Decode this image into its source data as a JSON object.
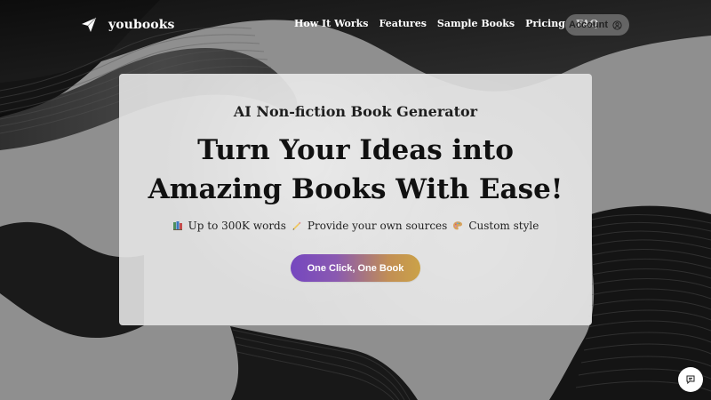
{
  "brand": {
    "name": "youbooks",
    "icon": "paper-plane-icon"
  },
  "nav": {
    "items": [
      {
        "label": "How It Works"
      },
      {
        "label": "Features"
      },
      {
        "label": "Sample Books"
      },
      {
        "label": "Pricing"
      },
      {
        "label": "FAQ"
      }
    ],
    "account_label": "Account",
    "account_icon": "user-circle-icon"
  },
  "hero": {
    "subtitle": "AI Non-fiction Book Generator",
    "title_line_1": "Turn Your Ideas into",
    "title_line_2": "Amazing Books With Ease!",
    "features": [
      {
        "icon": "books-icon",
        "label": "Up to 300K words"
      },
      {
        "icon": "pencil-icon",
        "label": "Provide your own sources"
      },
      {
        "icon": "palette-icon",
        "label": "Custom style"
      }
    ],
    "cta_label": "One Click, One Book"
  },
  "support": {
    "chat_icon": "chat-icon"
  },
  "colors": {
    "background": "#8f8f8f",
    "card": "#e4e4e4",
    "cta_start": "#7547bf",
    "cta_end": "#cba248"
  }
}
